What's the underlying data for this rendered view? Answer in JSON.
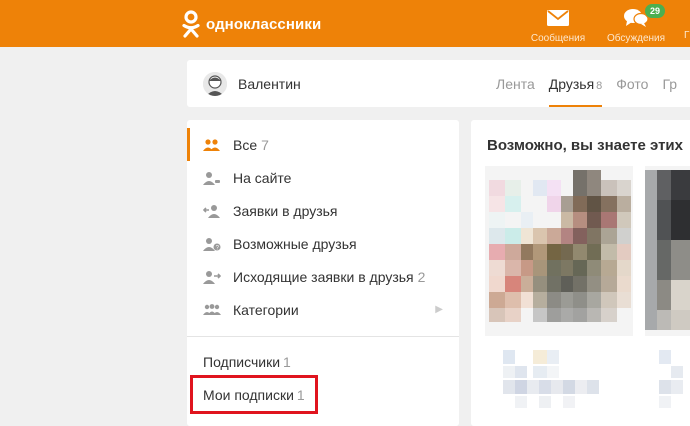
{
  "header": {
    "logo_text": "одноклассники",
    "messages_label": "Сообщения",
    "discussions_label": "Обсуждения",
    "discussions_badge": "29",
    "colors": {
      "brand": "#ee8208",
      "badge": "#4caf50"
    }
  },
  "profile": {
    "name": "Валентин",
    "tabs": [
      {
        "label": "Лента",
        "count": ""
      },
      {
        "label": "Друзья",
        "count": "8"
      },
      {
        "label": "Фото",
        "count": ""
      },
      {
        "label": "Гр",
        "count": ""
      }
    ]
  },
  "menu": {
    "items": [
      {
        "label": "Все",
        "count": "7",
        "icon": "friends-icon"
      },
      {
        "label": "На сайте",
        "count": "",
        "icon": "user-online-icon"
      },
      {
        "label": "Заявки в друзья",
        "count": "",
        "icon": "incoming-request-icon"
      },
      {
        "label": "Возможные друзья",
        "count": "",
        "icon": "possible-friends-icon"
      },
      {
        "label": "Исходящие заявки в друзья",
        "count": "2",
        "icon": "outgoing-request-icon"
      },
      {
        "label": "Категории",
        "count": "",
        "icon": "categories-icon"
      }
    ],
    "subscribers": {
      "label": "Подписчики",
      "count": "1"
    },
    "my_subscriptions": {
      "label": "Мои подписки",
      "count": "1"
    },
    "highlight_color": "#e0141e"
  },
  "recommendations": {
    "title": "Возможно, вы знаете этих"
  }
}
